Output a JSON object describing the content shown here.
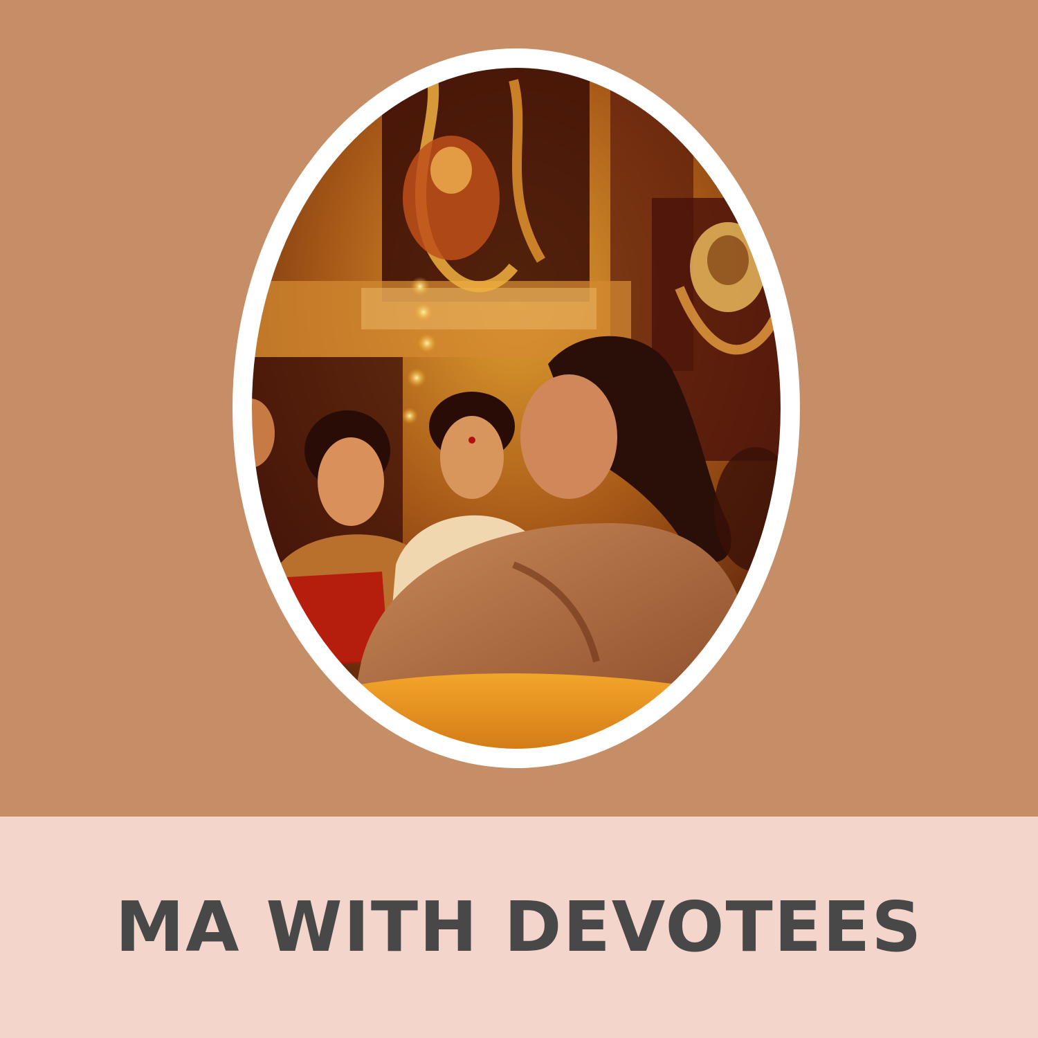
{
  "caption": {
    "text": "MA WITH DEVOTEES"
  },
  "colors": {
    "background_top": "#c68e66",
    "background_bottom": "#f4d5cb",
    "frame": "#ffffff",
    "caption_text": "#484848"
  },
  "photo": {
    "icon": "oval-photo-frame"
  }
}
